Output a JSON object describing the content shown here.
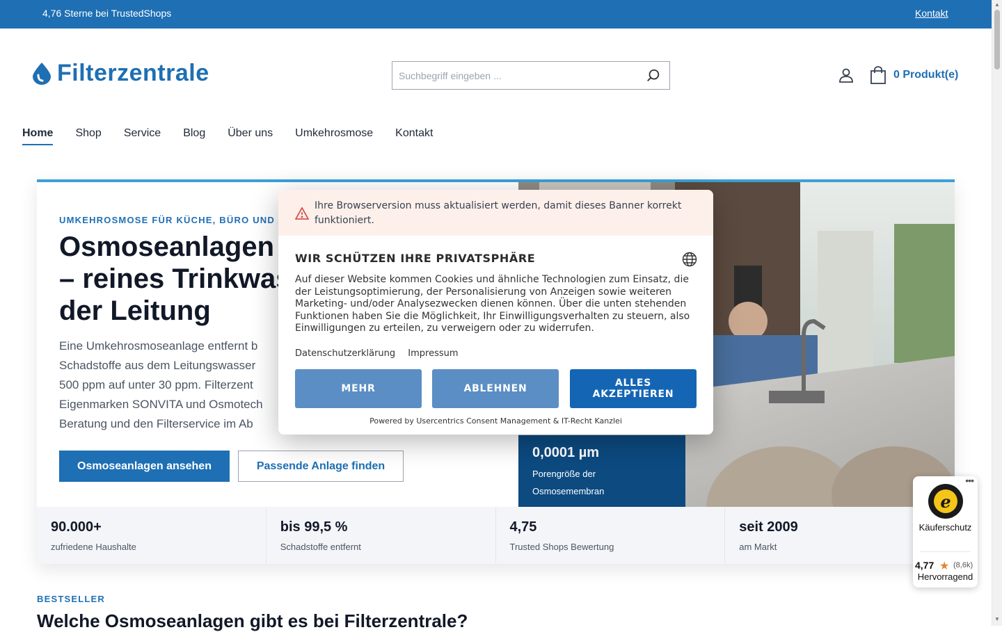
{
  "topbar": {
    "rating_text": "4,76 Sterne bei TrustedShops",
    "contact_link": "Kontakt"
  },
  "header": {
    "logo_text": "Filterzentrale",
    "search_placeholder": "Suchbegriff eingeben ...",
    "cart_label": "0 Produkt(e)"
  },
  "nav": {
    "items": [
      {
        "label": "Home",
        "active": true
      },
      {
        "label": "Shop"
      },
      {
        "label": "Service"
      },
      {
        "label": "Blog"
      },
      {
        "label": "Über uns"
      },
      {
        "label": "Umkehrosmose"
      },
      {
        "label": "Kontakt"
      }
    ]
  },
  "hero": {
    "eyebrow": "UMKEHROSMOSE FÜR KÜCHE, BÜRO UND A",
    "title_lines": [
      "Osmoseanlagen u",
      "– reines Trinkwas",
      "der Leitung"
    ],
    "description_lines": [
      "Eine Umkehrosmoseanlage entfernt b",
      "Schadstoffe aus dem Leitungswasser",
      "500 ppm auf unter 30 ppm. Filterzent",
      "Eigenmarken SONVITA und Osmotech",
      "Beratung und den Filterservice im Ab"
    ],
    "primary_button": "Osmoseanlagen ansehen",
    "secondary_button": "Passende Anlage finden",
    "badge_value": "0,0001 µm",
    "badge_label": "Porengröße der Osmosemembran"
  },
  "stats": [
    {
      "value": "90.000+",
      "label": "zufriedene Haushalte"
    },
    {
      "value": "bis 99,5 %",
      "label": "Schadstoffe entfernt"
    },
    {
      "value": "4,75",
      "label": "Trusted Shops Bewertung"
    },
    {
      "value": "seit 2009",
      "label": "am Markt"
    }
  ],
  "bestseller": {
    "label": "BESTSELLER",
    "title": "Welche Osmoseanlagen gibt es bei Filterzentrale?"
  },
  "consent": {
    "warning": "Ihre Browserversion muss aktualisiert werden, damit dieses Banner korrekt funktioniert.",
    "title": "WIR SCHÜTZEN IHRE PRIVATSPHÄRE",
    "body": "Auf dieser Website kommen Cookies und ähnliche Technologien zum Einsatz, die der Leistungsoptimierung, der Personalisierung von Anzeigen sowie weiteren Marketing- und/oder Analysezwecken dienen können. Über die unten stehenden Funktionen haben Sie die Möglichkeit, Ihr Einwilligungsverhalten zu steuern, also Einwilligungen zu erteilen, zu verweigern oder zu widerrufen.",
    "link_privacy": "Datenschutzerklärung",
    "link_imprint": "Impressum",
    "btn_more": "MEHR",
    "btn_decline": "ABLEHNEN",
    "btn_accept": "ALLES AKZEPTIEREN",
    "powered": "Powered by Usercentrics Consent Management & IT-Recht Kanzlei"
  },
  "trusted_shops": {
    "label": "Käuferschutz",
    "score": "4,77",
    "count": "(8,6k)",
    "quality": "Hervorragend"
  },
  "colors": {
    "brand_blue": "#1e6fb3",
    "dark_blue": "#0c4a80",
    "accent_line": "#3aa0d8",
    "star": "#e0852f"
  }
}
